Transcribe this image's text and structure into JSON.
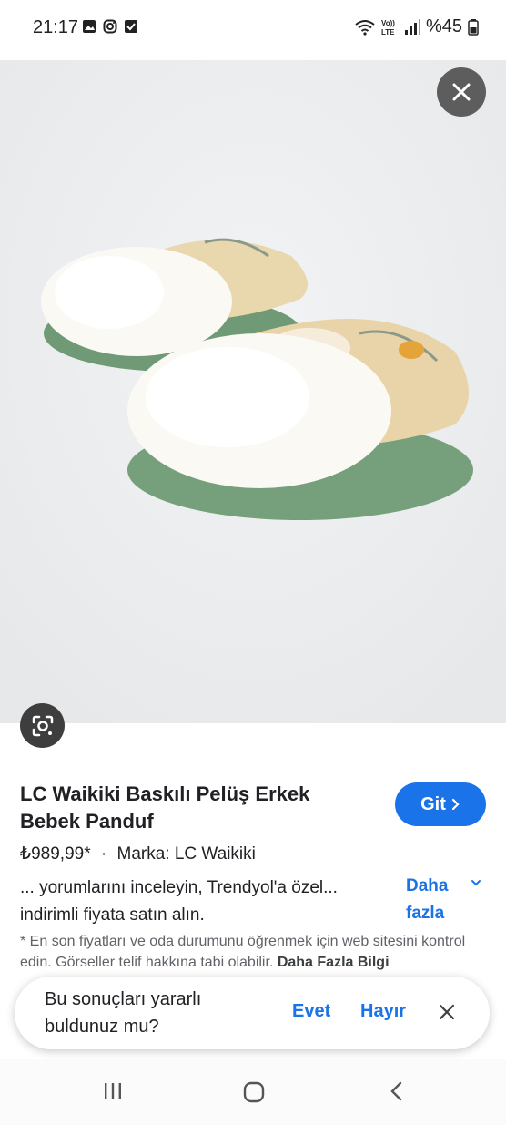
{
  "status": {
    "time": "21:17",
    "battery": "%45",
    "left_icons": [
      "gallery-icon",
      "instagram-icon",
      "check-icon"
    ],
    "right_icons": [
      "wifi-icon",
      "volte-icon",
      "signal-icon",
      "battery-icon"
    ],
    "volte_text": "Vo)) LTE"
  },
  "product": {
    "title": "LC Waikiki Baskılı Pelüş Erkek Bebek Panduf",
    "price": "₺989,99*",
    "separator": "·",
    "brand": "Marka: LC Waikiki",
    "description": "... yorumlarını inceleyin, Trendyol'a özel... indirimli fiyata satın alın.",
    "more_label": "Daha fazla",
    "go_button": "Git"
  },
  "disclaimer": {
    "text": "* En son fiyatları ve oda durumunu öğrenmek için web sitesini kontrol edin. Görseller telif hakkına tabi olabilir.",
    "link": "Daha Fazla Bilgi"
  },
  "feedback": {
    "question": "Bu sonuçları yararlı buldunuz mu?",
    "yes": "Evet",
    "no": "Hayır"
  },
  "colors": {
    "accent": "#1a73e8",
    "close_bg": "#5d5d5d",
    "lens_bg": "#3e3e3e"
  }
}
